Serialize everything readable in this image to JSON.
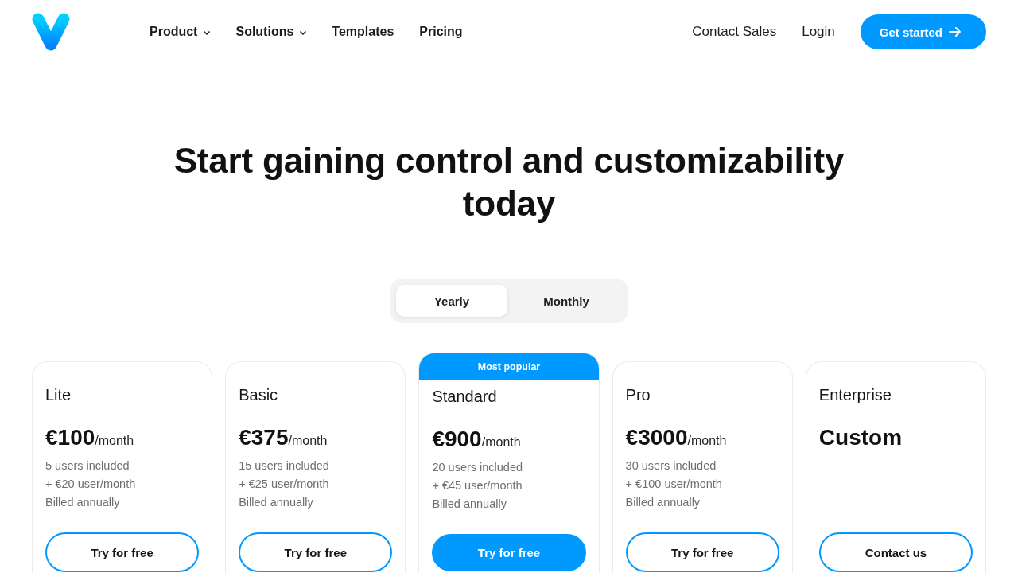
{
  "nav": {
    "links": [
      {
        "label": "Product",
        "has_menu": true
      },
      {
        "label": "Solutions",
        "has_menu": true
      },
      {
        "label": "Templates",
        "has_menu": false
      },
      {
        "label": "Pricing",
        "has_menu": false
      }
    ],
    "actions": [
      {
        "label": "Contact Sales",
        "kind": "link"
      },
      {
        "label": "Login",
        "kind": "link"
      },
      {
        "label": "Get started",
        "kind": "button"
      }
    ]
  },
  "headline": "Start gaining control and customizability today",
  "billing_toggle": [
    {
      "label": "Yearly",
      "selected": true
    },
    {
      "label": "Monthly",
      "selected": false
    }
  ],
  "plans": [
    {
      "name": "Lite",
      "price": "€100",
      "period": "/month",
      "details": [
        "5 users included",
        "+ €20 user/month",
        "Billed annually"
      ],
      "button": "Try for free",
      "featured": false
    },
    {
      "name": "Basic",
      "price": "€375",
      "period": "/month",
      "details": [
        "15 users included",
        "+ €25 user/month",
        "Billed annually"
      ],
      "button": "Try for free",
      "featured": false
    },
    {
      "badge": "Most popular",
      "name": "Standard",
      "price": "€900",
      "period": "/month",
      "details": [
        "20 users included",
        "+ €45 user/month",
        "Billed annually"
      ],
      "button": "Try for free",
      "featured": true
    },
    {
      "name": "Pro",
      "price": "€3000",
      "period": "/month",
      "details": [
        "30 users included",
        "+ €100 user/month",
        "Billed annually"
      ],
      "button": "Try for free",
      "featured": false
    },
    {
      "name": "Enterprise",
      "price": "Custom",
      "button": "Contact us",
      "featured": false
    }
  ]
}
